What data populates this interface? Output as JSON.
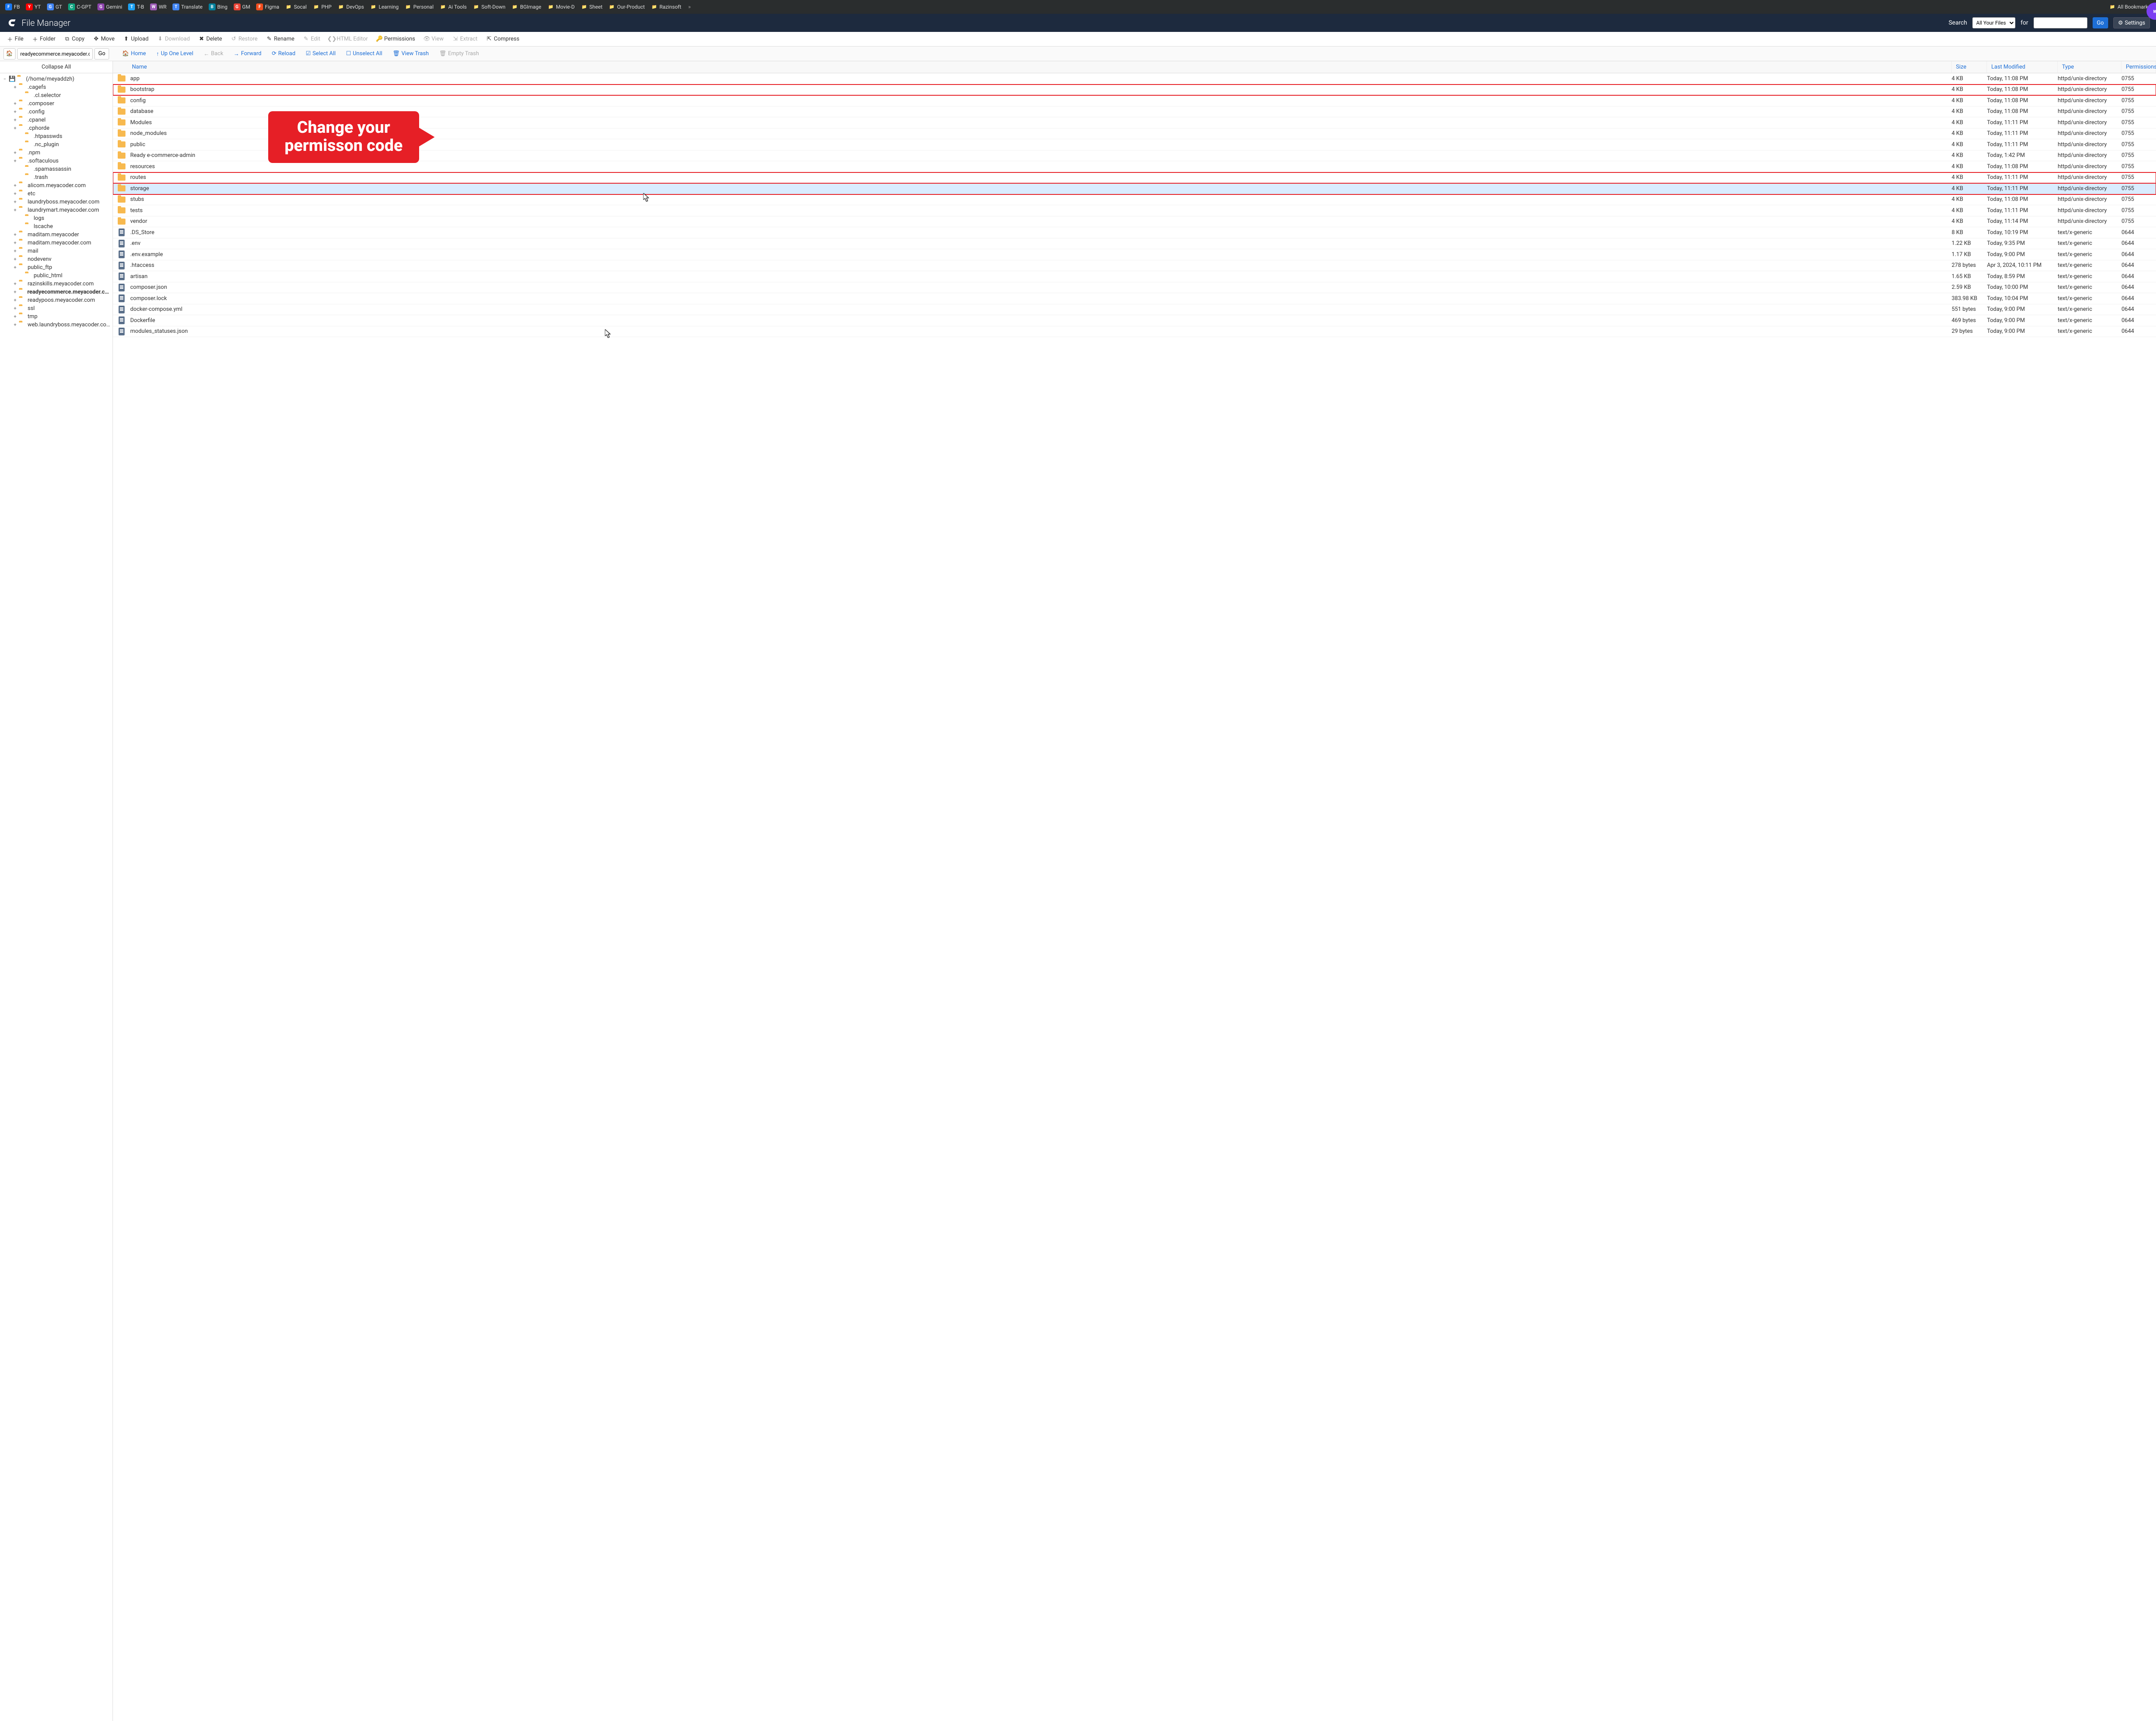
{
  "bookmarks": [
    {
      "label": "FB",
      "color": "#1877f2"
    },
    {
      "label": "YT",
      "color": "#ff0000"
    },
    {
      "label": "GT",
      "color": "#4285f4"
    },
    {
      "label": "C-GPT",
      "color": "#10a37f"
    },
    {
      "label": "Gemini",
      "color": "#8e44ad"
    },
    {
      "label": "T-B",
      "color": "#1da1f2"
    },
    {
      "label": "WR",
      "color": "#9b59b6"
    },
    {
      "label": "Translate",
      "color": "#4285f4"
    },
    {
      "label": "Bing",
      "color": "#00809d"
    },
    {
      "label": "GM",
      "color": "#ea4335"
    },
    {
      "label": "Figma",
      "color": "#f24e1e"
    },
    {
      "label": "Socal",
      "folder": true
    },
    {
      "label": "PHP",
      "folder": true
    },
    {
      "label": "DevOps",
      "folder": true
    },
    {
      "label": "Learning",
      "folder": true
    },
    {
      "label": "Personal",
      "folder": true
    },
    {
      "label": "Ai Tools",
      "folder": true
    },
    {
      "label": "Soft-Down",
      "folder": true
    },
    {
      "label": "BGImage",
      "folder": true
    },
    {
      "label": "Movie-D",
      "folder": true
    },
    {
      "label": "Sheet",
      "folder": true
    },
    {
      "label": "Our-Product",
      "folder": true
    },
    {
      "label": "Razinsoft",
      "folder": true
    }
  ],
  "all_bookmarks_label": "All Bookmarks",
  "header": {
    "title": "File Manager",
    "search_label": "Search",
    "search_scope": "All Your Files",
    "for_label": "for",
    "go_label": "Go",
    "settings_label": "Settings"
  },
  "toolbar": {
    "file": "File",
    "folder": "Folder",
    "copy": "Copy",
    "move": "Move",
    "upload": "Upload",
    "download": "Download",
    "delete": "Delete",
    "restore": "Restore",
    "rename": "Rename",
    "edit": "Edit",
    "html_editor": "HTML Editor",
    "permissions": "Permissions",
    "view": "View",
    "extract": "Extract",
    "compress": "Compress"
  },
  "nav": {
    "path": "readyecommerce.meyacoder.c",
    "go": "Go",
    "home": "Home",
    "up": "Up One Level",
    "back": "Back",
    "forward": "Forward",
    "reload": "Reload",
    "select_all": "Select All",
    "unselect_all": "Unselect All",
    "view_trash": "View Trash",
    "empty_trash": "Empty Trash"
  },
  "sidebar": {
    "collapse_all": "Collapse All",
    "root": "(/home/meyaddzh)",
    "items": [
      {
        "label": ".cagefs",
        "indent": 1,
        "expandable": true
      },
      {
        "label": ".cl.selector",
        "indent": 2,
        "expandable": false
      },
      {
        "label": ".composer",
        "indent": 1,
        "expandable": true
      },
      {
        "label": ".config",
        "indent": 1,
        "expandable": true
      },
      {
        "label": ".cpanel",
        "indent": 1,
        "expandable": true
      },
      {
        "label": ".cphorde",
        "indent": 1,
        "expandable": true
      },
      {
        "label": ".htpasswds",
        "indent": 2,
        "expandable": false
      },
      {
        "label": ".nc_plugin",
        "indent": 2,
        "expandable": false
      },
      {
        "label": ".npm",
        "indent": 1,
        "expandable": true
      },
      {
        "label": ".softaculous",
        "indent": 1,
        "expandable": true
      },
      {
        "label": ".spamassassin",
        "indent": 2,
        "expandable": false
      },
      {
        "label": ".trash",
        "indent": 2,
        "expandable": false
      },
      {
        "label": "alicom.meyacoder.com",
        "indent": 1,
        "expandable": true
      },
      {
        "label": "etc",
        "indent": 1,
        "expandable": true
      },
      {
        "label": "laundryboss.meyacoder.com",
        "indent": 1,
        "expandable": true
      },
      {
        "label": "laundrymart.meyacoder.com",
        "indent": 1,
        "expandable": true
      },
      {
        "label": "logs",
        "indent": 2,
        "expandable": false
      },
      {
        "label": "lscache",
        "indent": 2,
        "expandable": false
      },
      {
        "label": "maditam.meyacoder",
        "indent": 1,
        "expandable": true
      },
      {
        "label": "maditam.meyacoder.com",
        "indent": 1,
        "expandable": true
      },
      {
        "label": "mail",
        "indent": 1,
        "expandable": true
      },
      {
        "label": "nodevenv",
        "indent": 1,
        "expandable": true
      },
      {
        "label": "public_ftp",
        "indent": 1,
        "expandable": true
      },
      {
        "label": "public_html",
        "indent": 2,
        "expandable": false
      },
      {
        "label": "razinskills.meyacoder.com",
        "indent": 1,
        "expandable": true
      },
      {
        "label": "readyecommerce.meyacoder.com",
        "indent": 1,
        "expandable": true,
        "bold": true
      },
      {
        "label": "readypoos.meyacoder.com",
        "indent": 1,
        "expandable": true
      },
      {
        "label": "ssl",
        "indent": 1,
        "expandable": true
      },
      {
        "label": "tmp",
        "indent": 1,
        "expandable": true
      },
      {
        "label": "web.laundryboss.meyacoder.com",
        "indent": 1,
        "expandable": true
      }
    ]
  },
  "columns": {
    "name": "Name",
    "size": "Size",
    "modified": "Last Modified",
    "type": "Type",
    "permissions": "Permissions"
  },
  "rows": [
    {
      "name": "app",
      "size": "4 KB",
      "mod": "Today, 11:08 PM",
      "type": "httpd/unix-directory",
      "perm": "0755",
      "folder": true
    },
    {
      "name": "bootstrap",
      "size": "4 KB",
      "mod": "Today, 11:08 PM",
      "type": "httpd/unix-directory",
      "perm": "0755",
      "folder": true,
      "hl": true
    },
    {
      "name": "config",
      "size": "4 KB",
      "mod": "Today, 11:08 PM",
      "type": "httpd/unix-directory",
      "perm": "0755",
      "folder": true
    },
    {
      "name": "database",
      "size": "4 KB",
      "mod": "Today, 11:08 PM",
      "type": "httpd/unix-directory",
      "perm": "0755",
      "folder": true
    },
    {
      "name": "Modules",
      "size": "4 KB",
      "mod": "Today, 11:11 PM",
      "type": "httpd/unix-directory",
      "perm": "0755",
      "folder": true
    },
    {
      "name": "node_modules",
      "size": "4 KB",
      "mod": "Today, 11:11 PM",
      "type": "httpd/unix-directory",
      "perm": "0755",
      "folder": true
    },
    {
      "name": "public",
      "size": "4 KB",
      "mod": "Today, 11:11 PM",
      "type": "httpd/unix-directory",
      "perm": "0755",
      "folder": true
    },
    {
      "name": "Ready e-commerce-admin",
      "size": "4 KB",
      "mod": "Today, 1:42 PM",
      "type": "httpd/unix-directory",
      "perm": "0755",
      "folder": true
    },
    {
      "name": "resources",
      "size": "4 KB",
      "mod": "Today, 11:08 PM",
      "type": "httpd/unix-directory",
      "perm": "0755",
      "folder": true
    },
    {
      "name": "routes",
      "size": "4 KB",
      "mod": "Today, 11:11 PM",
      "type": "httpd/unix-directory",
      "perm": "0755",
      "folder": true,
      "hl": true
    },
    {
      "name": "storage",
      "size": "4 KB",
      "mod": "Today, 11:11 PM",
      "type": "httpd/unix-directory",
      "perm": "0755",
      "folder": true,
      "hl": true,
      "sel": true
    },
    {
      "name": "stubs",
      "size": "4 KB",
      "mod": "Today, 11:08 PM",
      "type": "httpd/unix-directory",
      "perm": "0755",
      "folder": true
    },
    {
      "name": "tests",
      "size": "4 KB",
      "mod": "Today, 11:11 PM",
      "type": "httpd/unix-directory",
      "perm": "0755",
      "folder": true
    },
    {
      "name": "vendor",
      "size": "4 KB",
      "mod": "Today, 11:14 PM",
      "type": "httpd/unix-directory",
      "perm": "0755",
      "folder": true
    },
    {
      "name": ".DS_Store",
      "size": "8 KB",
      "mod": "Today, 10:19 PM",
      "type": "text/x-generic",
      "perm": "0644",
      "folder": false
    },
    {
      "name": ".env",
      "size": "1.22 KB",
      "mod": "Today, 9:35 PM",
      "type": "text/x-generic",
      "perm": "0644",
      "folder": false
    },
    {
      "name": ".env.example",
      "size": "1.17 KB",
      "mod": "Today, 9:00 PM",
      "type": "text/x-generic",
      "perm": "0644",
      "folder": false
    },
    {
      "name": ".htaccess",
      "size": "278 bytes",
      "mod": "Apr 3, 2024, 10:11 PM",
      "type": "text/x-generic",
      "perm": "0644",
      "folder": false
    },
    {
      "name": "artisan",
      "size": "1.65 KB",
      "mod": "Today, 8:59 PM",
      "type": "text/x-generic",
      "perm": "0644",
      "folder": false
    },
    {
      "name": "composer.json",
      "size": "2.59 KB",
      "mod": "Today, 10:00 PM",
      "type": "text/x-generic",
      "perm": "0644",
      "folder": false
    },
    {
      "name": "composer.lock",
      "size": "383.98 KB",
      "mod": "Today, 10:04 PM",
      "type": "text/x-generic",
      "perm": "0644",
      "folder": false
    },
    {
      "name": "docker-compose.yml",
      "size": "551 bytes",
      "mod": "Today, 9:00 PM",
      "type": "text/x-generic",
      "perm": "0644",
      "folder": false
    },
    {
      "name": "Dockerfile",
      "size": "469 bytes",
      "mod": "Today, 9:00 PM",
      "type": "text/x-generic",
      "perm": "0644",
      "folder": false
    },
    {
      "name": "modules_statuses.json",
      "size": "29 bytes",
      "mod": "Today, 9:00 PM",
      "type": "text/x-generic",
      "perm": "0644",
      "folder": false
    }
  ],
  "callout": {
    "line1": "Change your",
    "line2": "permisson code"
  }
}
